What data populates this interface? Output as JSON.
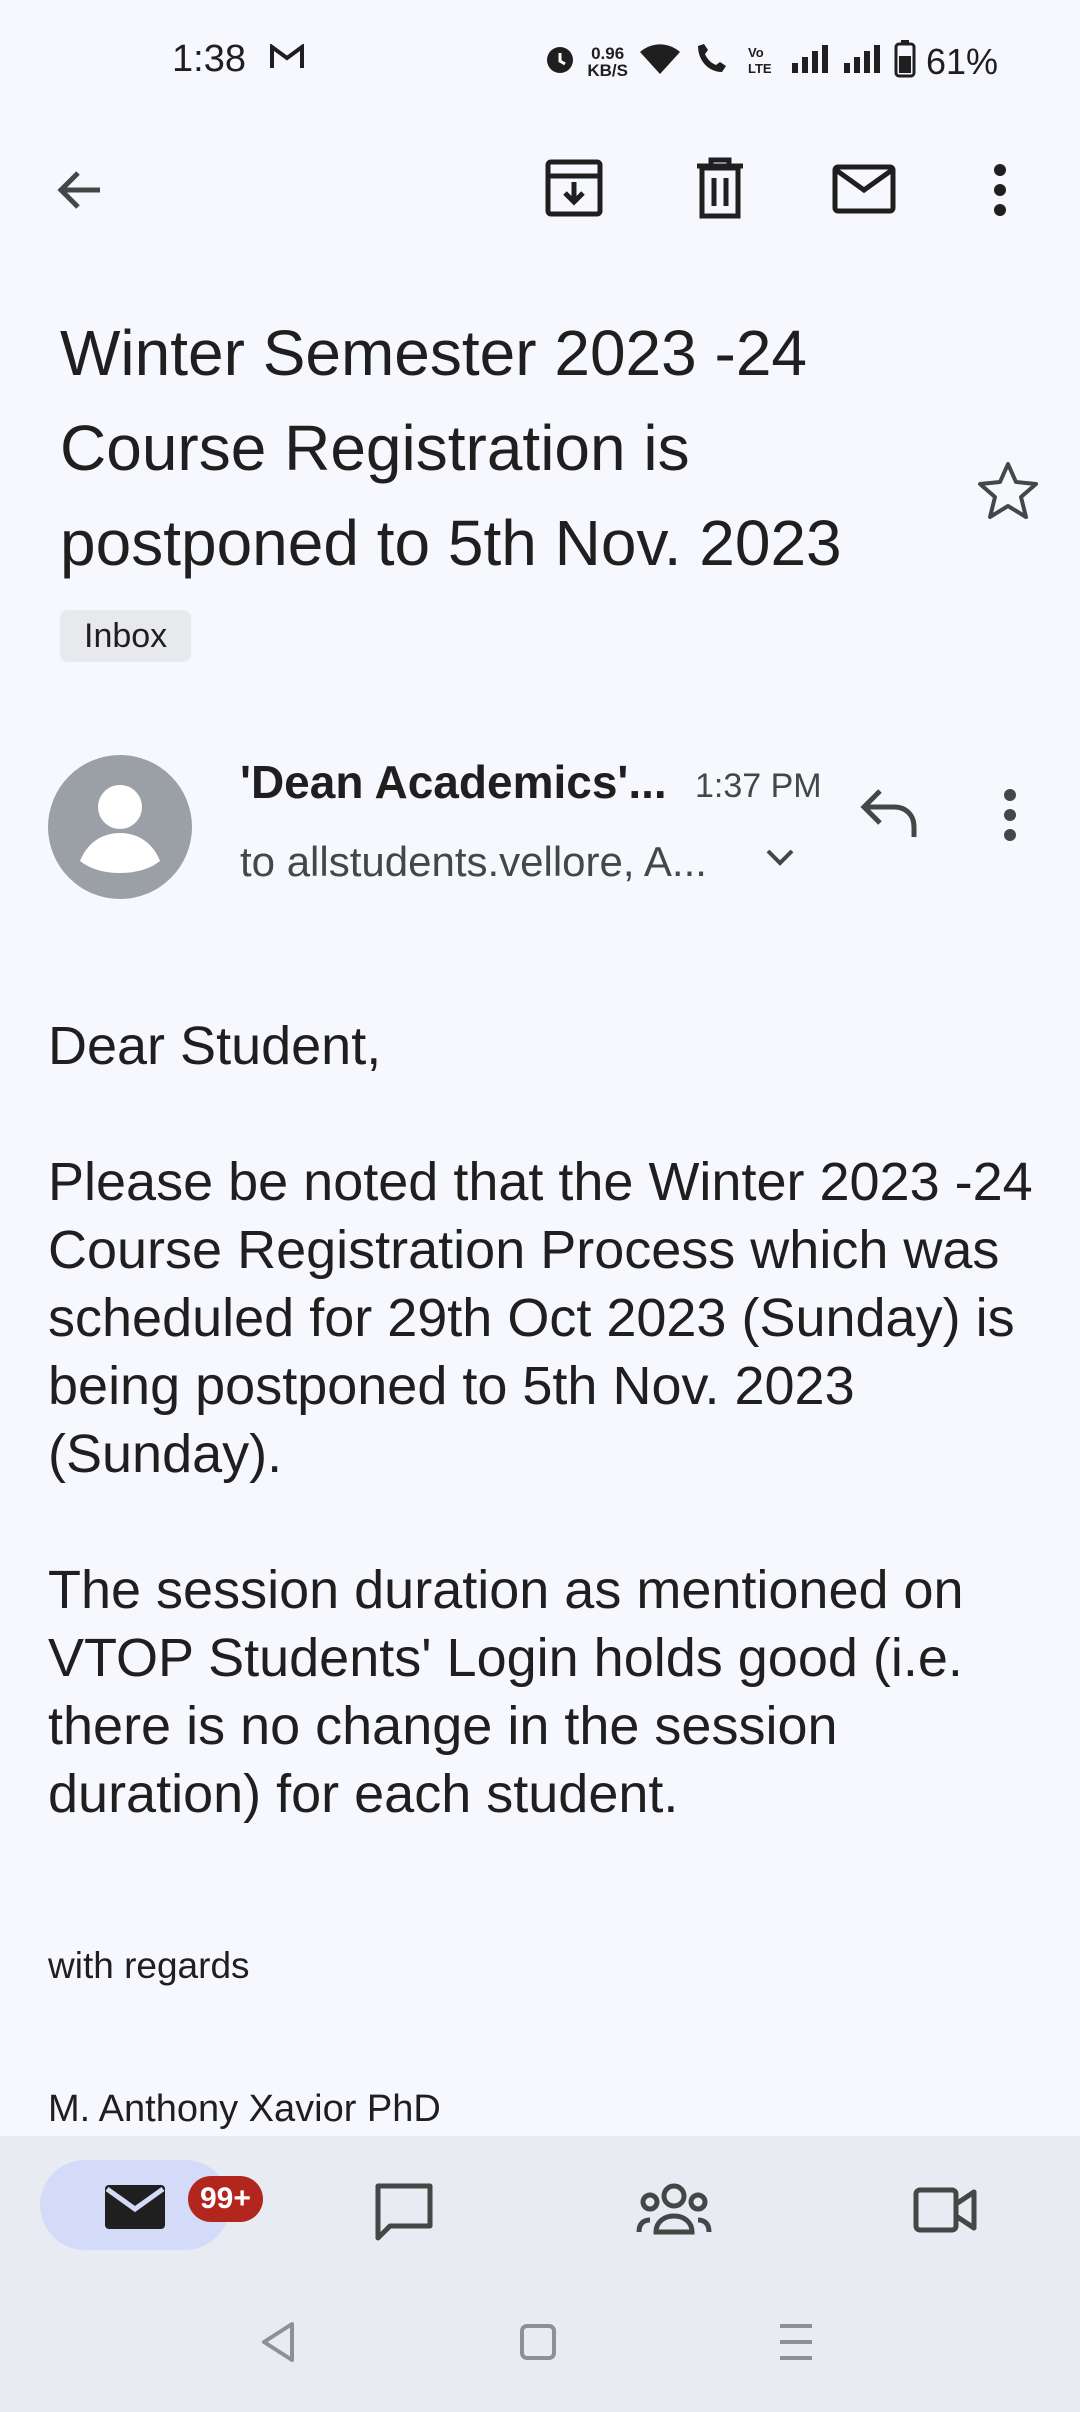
{
  "status_bar": {
    "time": "1:38",
    "net_speed_value": "0.96",
    "net_speed_unit": "KB/S",
    "battery": "61%"
  },
  "toolbar": {
    "icons": [
      "back-arrow-icon",
      "archive-icon",
      "delete-icon",
      "mark-unread-icon",
      "more-vert-icon"
    ]
  },
  "email": {
    "subject": "Winter Semester 2023 -24 Course Registration is postponed to 5th Nov. 2023",
    "label": "Inbox",
    "sender": "'Dean Academics'...",
    "time": "1:37 PM",
    "recipients": "to allstudents.vellore, A...",
    "body": [
      "Dear Student,",
      "Please be noted that the Winter 2023 -24 Course Registration Process which was scheduled for 29th Oct 2023 (Sunday) is being postponed to 5th Nov. 2023 (Sunday).",
      "The session duration as mentioned on VTOP Students' Login holds good (i.e. there is no change in the session duration) for each student."
    ],
    "regards": "with regards",
    "signature": "M. Anthony Xavior PhD"
  },
  "bottom_nav": {
    "mail_badge": "99+",
    "items": [
      "mail-icon",
      "chat-icon",
      "spaces-icon",
      "meet-icon"
    ]
  },
  "colors": {
    "background": "#f7f8fd",
    "nav_background": "#e9ebf3",
    "active_pill": "#d4dbf8",
    "badge": "#b3261e",
    "avatar": "#9aa0a6"
  }
}
